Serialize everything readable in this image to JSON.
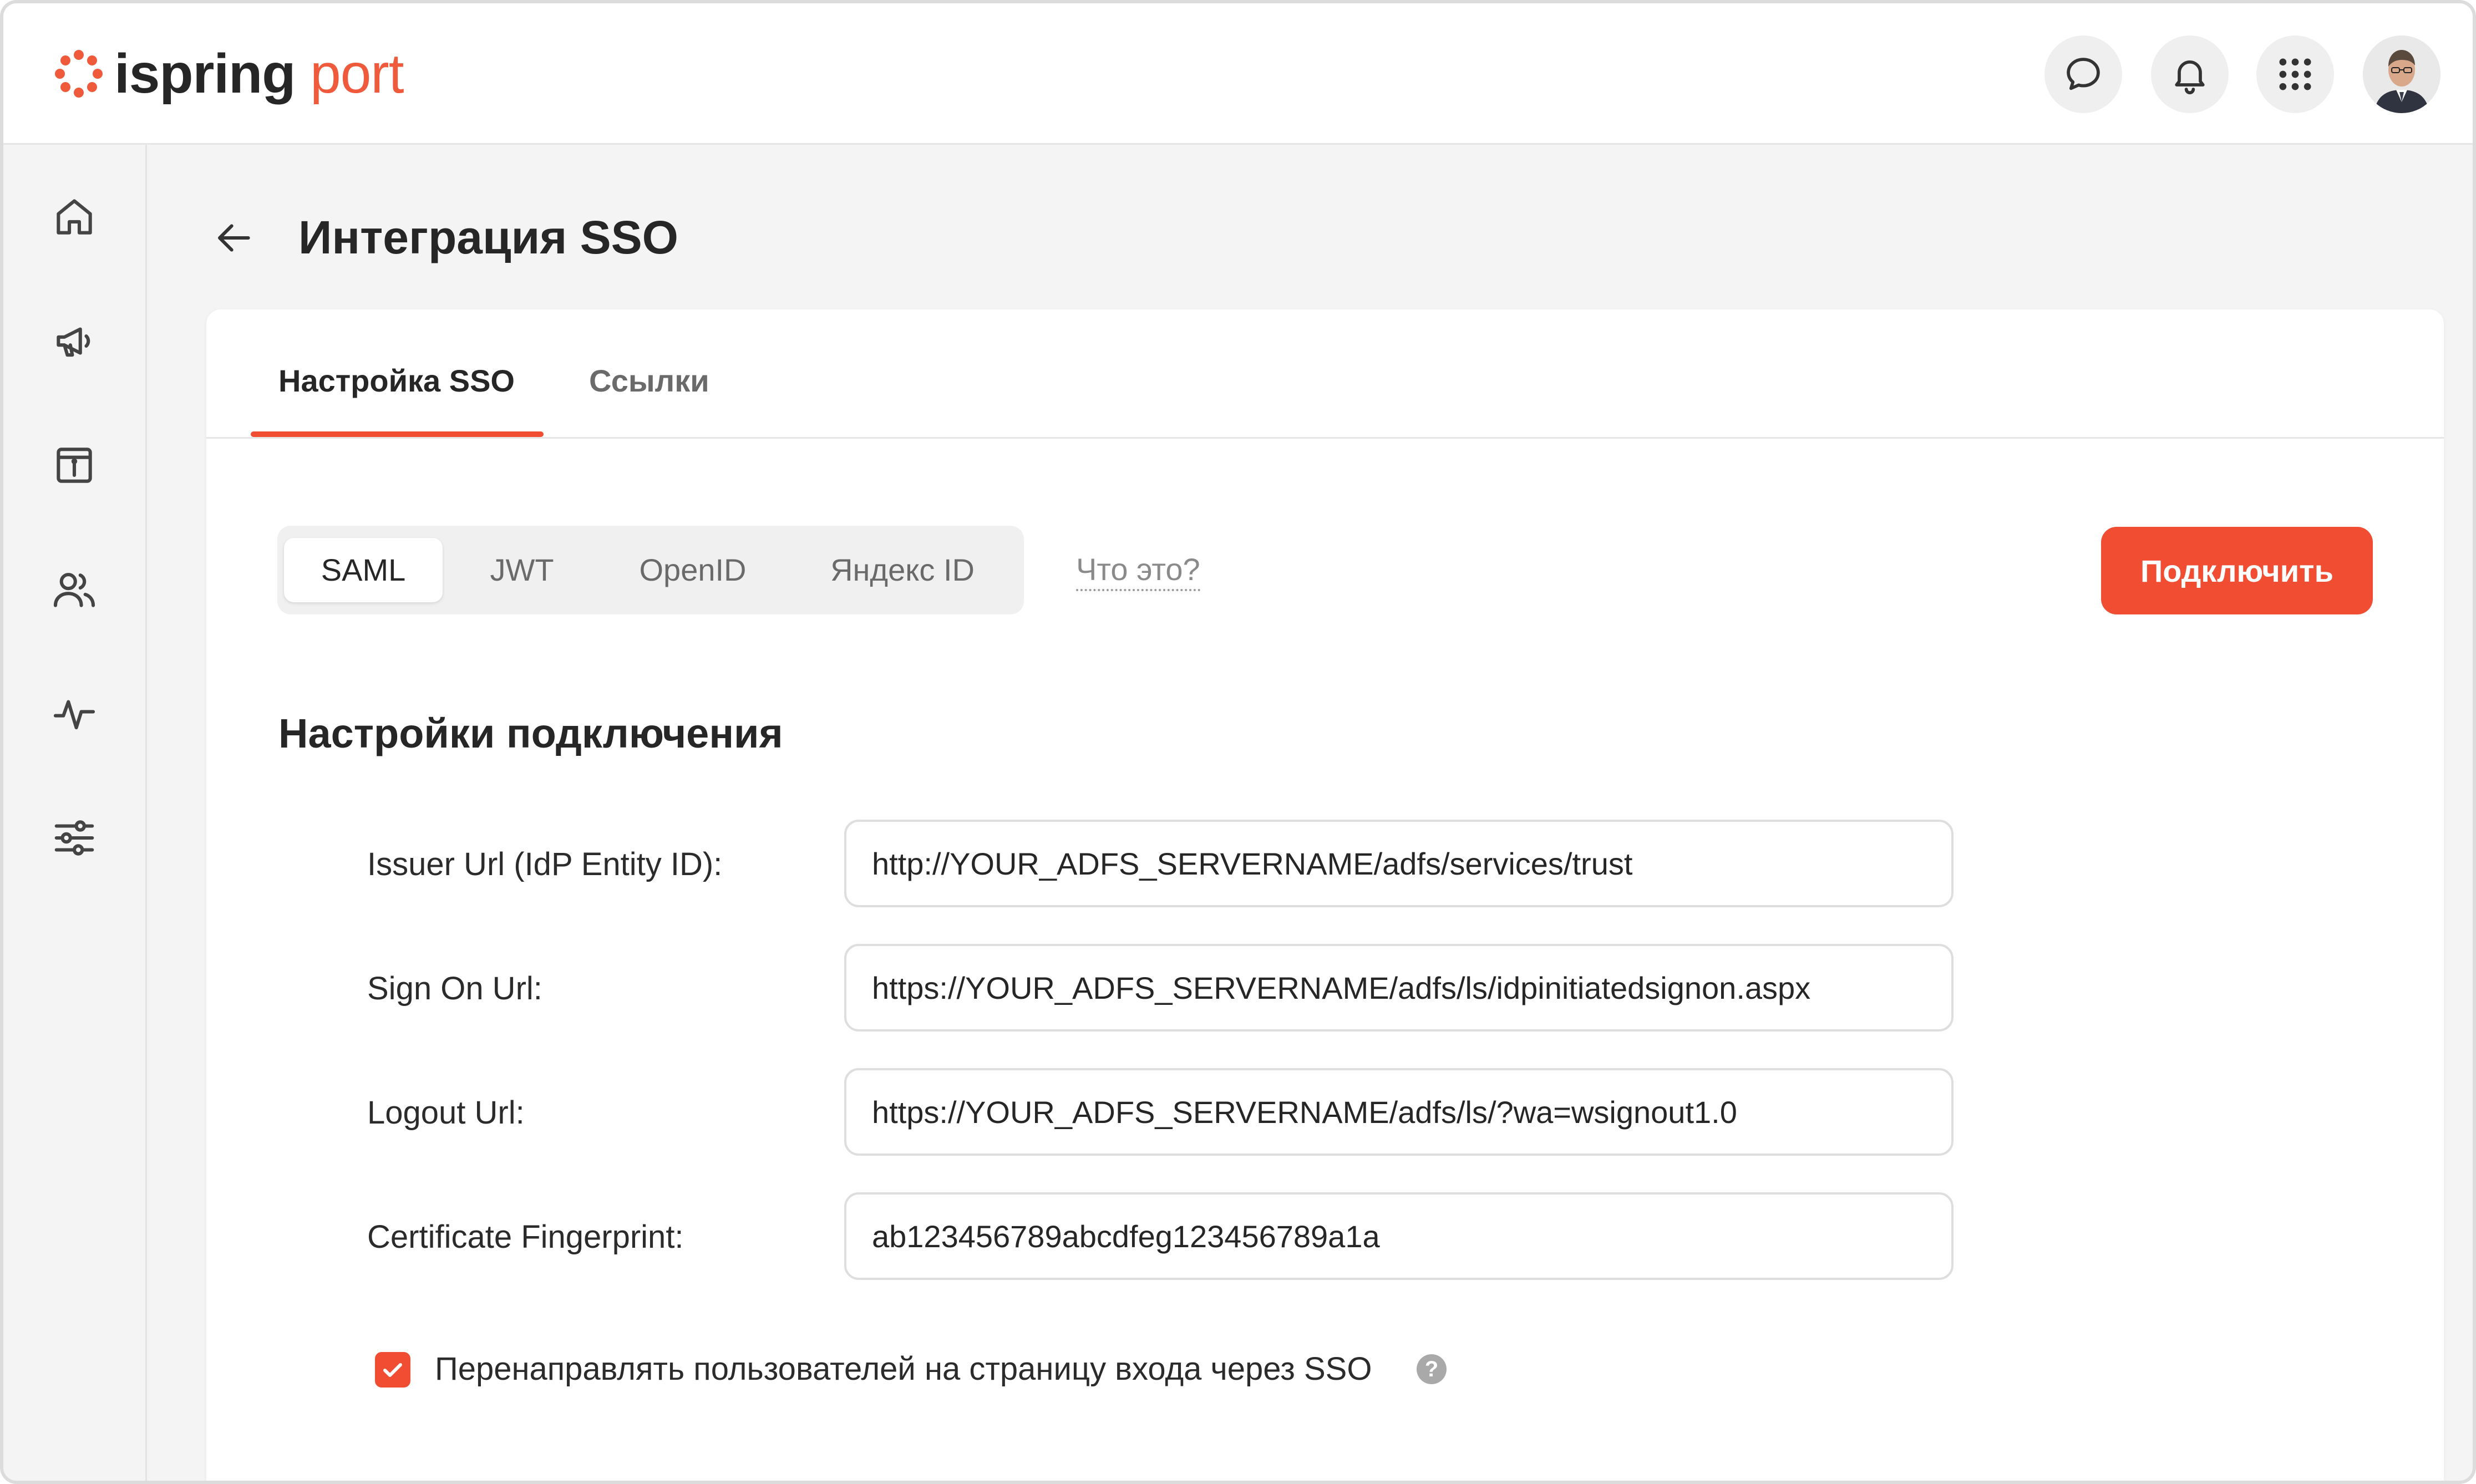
{
  "header": {
    "logo_word1": "ispring",
    "logo_word2": "port",
    "icons": [
      "chat-icon",
      "bell-icon",
      "apps-grid-icon"
    ],
    "avatar": "user-avatar"
  },
  "sidebar": {
    "items": [
      {
        "icon": "home-icon"
      },
      {
        "icon": "megaphone-icon"
      },
      {
        "icon": "info-calendar-icon"
      },
      {
        "icon": "users-icon"
      },
      {
        "icon": "activity-icon"
      },
      {
        "icon": "sliders-icon"
      }
    ]
  },
  "page": {
    "title": "Интеграция SSO"
  },
  "tabs": [
    {
      "label": "Настройка SSO",
      "active": true
    },
    {
      "label": "Ссылки",
      "active": false
    }
  ],
  "protocols": {
    "options": [
      "SAML",
      "JWT",
      "OpenID",
      "Яндекс ID"
    ],
    "selected": "SAML"
  },
  "what_is_link": "Что это?",
  "connect_button": "Подключить",
  "section_title": "Настройки подключения",
  "fields": [
    {
      "label": "Issuer Url (IdP Entity ID):",
      "value": "http://YOUR_ADFS_SERVERNAME/adfs/services/trust"
    },
    {
      "label": "Sign On Url:",
      "value": "https://YOUR_ADFS_SERVERNAME/adfs/ls/idpinitiatedsignon.aspx"
    },
    {
      "label": "Logout Url:",
      "value": "https://YOUR_ADFS_SERVERNAME/adfs/ls/?wa=wsignout1.0"
    },
    {
      "label": "Certificate Fingerprint:",
      "value": "ab123456789abcdfeg123456789a1a"
    }
  ],
  "redirect_checkbox": {
    "label": "Перенаправлять пользователей на страницу входа через SSO",
    "checked": true,
    "help": "?"
  },
  "colors": {
    "accent": "#f04d33",
    "logo_accent": "#f05a3c",
    "background": "#f4f4f4"
  }
}
